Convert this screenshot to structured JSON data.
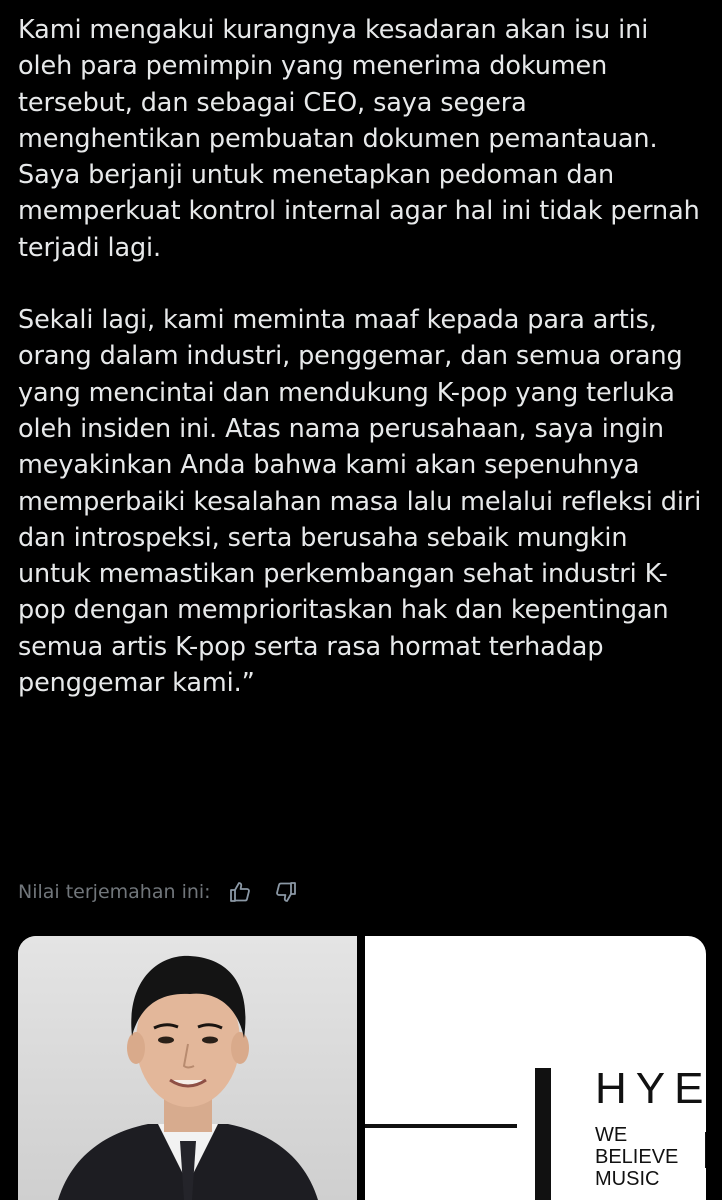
{
  "post": {
    "paragraph_1": "Kami mengakui kurangnya kesadaran akan isu ini oleh para pemimpin yang menerima dokumen tersebut, dan sebagai CEO, saya segera menghentikan pembuatan dokumen pemantauan. Saya berjanji untuk menetapkan pedoman dan memperkuat kontrol internal agar hal ini tidak pernah terjadi lagi.",
    "paragraph_2": "Sekali lagi, kami meminta maaf kepada para artis, orang dalam industri, penggemar, dan semua orang yang mencintai dan mendukung K-pop yang terluka oleh insiden ini. Atas nama perusahaan, saya ingin meyakinkan Anda bahwa kami akan sepenuhnya memperbaiki kesalahan masa lalu melalui refleksi diri dan introspeksi, serta berusaha sebaik mungkin untuk memastikan perkembangan sehat industri K-pop dengan memprioritaskan hak dan kepentingan semua artis K-pop serta rasa hormat terhadap penggemar kami.”"
  },
  "translation_rating": {
    "label": "Nilai terjemahan ini:",
    "like_icon": "thumbs-up-icon",
    "dislike_icon": "thumbs-down-icon"
  },
  "media": {
    "logo_title": "HYE",
    "logo_tagline": [
      "WE",
      "BELIEVE",
      "MUSIC"
    ]
  },
  "colors": {
    "background": "#000000",
    "text": "#e7e9ea",
    "muted": "#71767b"
  }
}
